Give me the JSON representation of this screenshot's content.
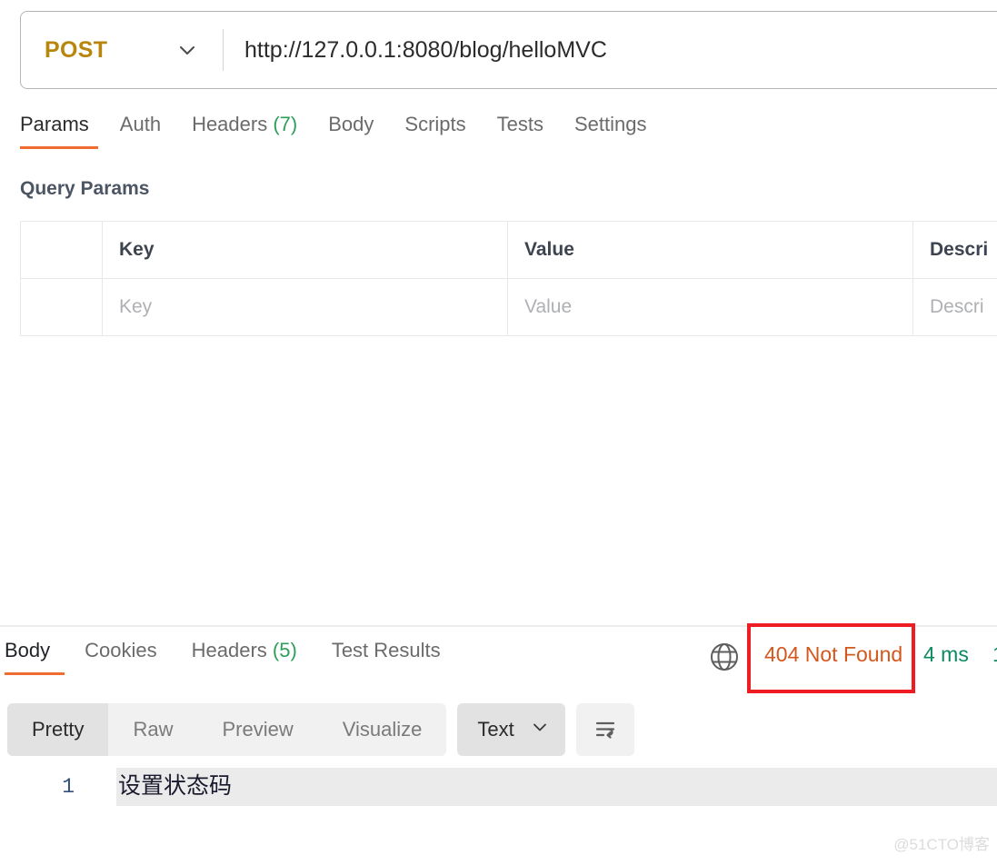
{
  "request": {
    "method": "POST",
    "method_chevron_icon": "chevron-down-icon",
    "url": "http://127.0.0.1:8080/blog/helloMVC",
    "tabs": [
      {
        "label": "Params",
        "count": "",
        "active": true
      },
      {
        "label": "Auth",
        "count": "",
        "active": false
      },
      {
        "label": "Headers",
        "count": "(7)",
        "active": false
      },
      {
        "label": "Body",
        "count": "",
        "active": false
      },
      {
        "label": "Scripts",
        "count": "",
        "active": false
      },
      {
        "label": "Tests",
        "count": "",
        "active": false
      },
      {
        "label": "Settings",
        "count": "",
        "active": false
      }
    ],
    "query_params": {
      "section_title": "Query Params",
      "columns": [
        "",
        "Key",
        "Value",
        "Descri"
      ],
      "rows": [
        {
          "check": "",
          "key": "Key",
          "value": "Value",
          "description": "Descri"
        }
      ]
    }
  },
  "response": {
    "tabs": [
      {
        "label": "Body",
        "count": "",
        "active": true
      },
      {
        "label": "Cookies",
        "count": "",
        "active": false
      },
      {
        "label": "Headers",
        "count": "(5)",
        "active": false
      },
      {
        "label": "Test Results",
        "count": "",
        "active": false
      }
    ],
    "status": {
      "globe_icon": "globe-icon",
      "code_text": "404 Not Found",
      "time": "4 ms",
      "size": "1",
      "annotation_color": "#ee1c23",
      "status_color": "#d4571d",
      "time_color": "#0c8a5e"
    },
    "viewer": {
      "modes": [
        {
          "label": "Pretty",
          "active": true
        },
        {
          "label": "Raw",
          "active": false
        },
        {
          "label": "Preview",
          "active": false
        },
        {
          "label": "Visualize",
          "active": false
        }
      ],
      "format": "Text",
      "format_chevron_icon": "chevron-down-icon",
      "wrap_icon": "wrap-lines-icon"
    },
    "body": {
      "lines": [
        {
          "number": "1",
          "text": "设置状态码"
        }
      ]
    }
  },
  "watermark": "@51CTO博客",
  "theme": {
    "accent": "#ef6c33",
    "method_color": "#b8860b",
    "count_color": "#2e9e5b"
  }
}
